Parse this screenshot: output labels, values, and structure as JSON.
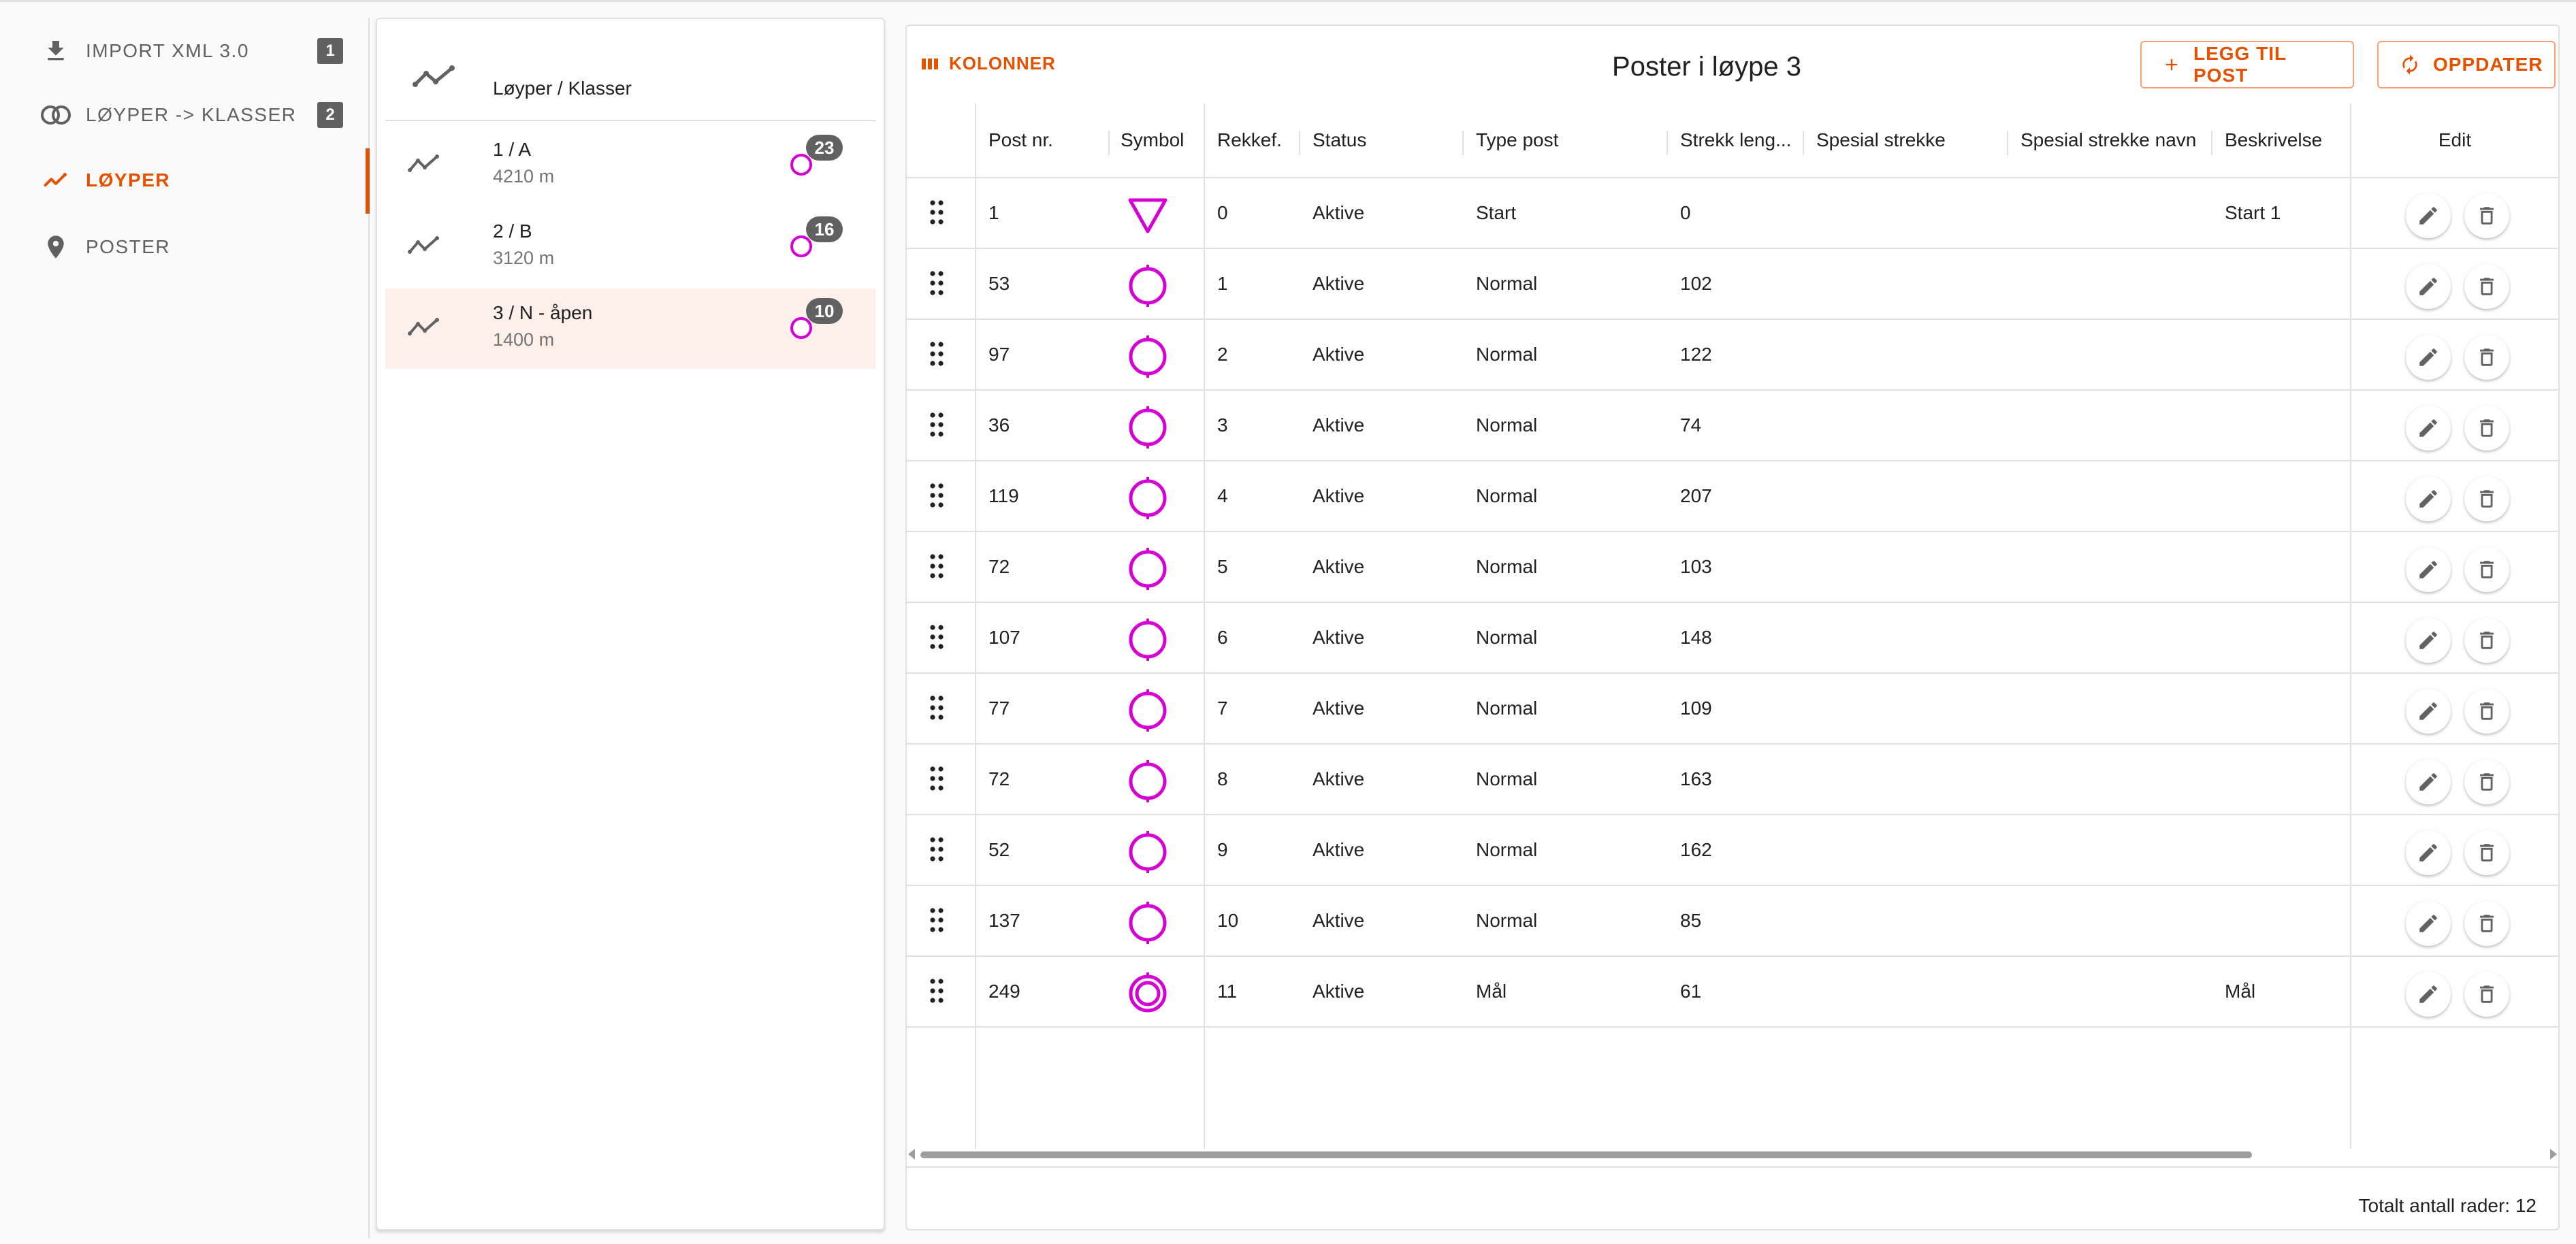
{
  "nav": {
    "items": [
      {
        "label": "IMPORT XML 3.0",
        "badge": "1",
        "icon": "download-icon"
      },
      {
        "label": "LØYPER -> KLASSER",
        "badge": "2",
        "icon": "link-circles-icon"
      },
      {
        "label": "LØYPER",
        "badge": "",
        "icon": "route-icon"
      },
      {
        "label": "POSTER",
        "badge": "",
        "icon": "location-pin-icon"
      }
    ]
  },
  "routes_panel": {
    "header": "Løyper / Klasser",
    "routes": [
      {
        "name": "1 / A",
        "length": "4210 m",
        "count": "23"
      },
      {
        "name": "2 / B",
        "length": "3120 m",
        "count": "16"
      },
      {
        "name": "3 / N - åpen",
        "length": "1400 m",
        "count": "10"
      }
    ]
  },
  "main": {
    "title": "Poster i løype 3",
    "columns_button": "KOLONNER",
    "add_button": "LEGG TIL POST",
    "refresh_button": "OPPDATER",
    "headers": {
      "post_nr": "Post nr.",
      "symbol": "Symbol",
      "order": "Rekkef.",
      "status": "Status",
      "type": "Type post",
      "length": "Strekk leng...",
      "special": "Spesial strekke",
      "special_name": "Spesial strekke navn",
      "description": "Beskrivelse",
      "edit": "Edit"
    },
    "rows": [
      {
        "post": "1",
        "symbol": "start",
        "order": "0",
        "status": "Aktive",
        "type": "Start",
        "length": "0",
        "special": "",
        "special_name": "",
        "description": "Start 1"
      },
      {
        "post": "53",
        "symbol": "control",
        "order": "1",
        "status": "Aktive",
        "type": "Normal",
        "length": "102",
        "special": "",
        "special_name": "",
        "description": ""
      },
      {
        "post": "97",
        "symbol": "control",
        "order": "2",
        "status": "Aktive",
        "type": "Normal",
        "length": "122",
        "special": "",
        "special_name": "",
        "description": ""
      },
      {
        "post": "36",
        "symbol": "control",
        "order": "3",
        "status": "Aktive",
        "type": "Normal",
        "length": "74",
        "special": "",
        "special_name": "",
        "description": ""
      },
      {
        "post": "119",
        "symbol": "control",
        "order": "4",
        "status": "Aktive",
        "type": "Normal",
        "length": "207",
        "special": "",
        "special_name": "",
        "description": ""
      },
      {
        "post": "72",
        "symbol": "control",
        "order": "5",
        "status": "Aktive",
        "type": "Normal",
        "length": "103",
        "special": "",
        "special_name": "",
        "description": ""
      },
      {
        "post": "107",
        "symbol": "control",
        "order": "6",
        "status": "Aktive",
        "type": "Normal",
        "length": "148",
        "special": "",
        "special_name": "",
        "description": ""
      },
      {
        "post": "77",
        "symbol": "control",
        "order": "7",
        "status": "Aktive",
        "type": "Normal",
        "length": "109",
        "special": "",
        "special_name": "",
        "description": ""
      },
      {
        "post": "72",
        "symbol": "control",
        "order": "8",
        "status": "Aktive",
        "type": "Normal",
        "length": "163",
        "special": "",
        "special_name": "",
        "description": ""
      },
      {
        "post": "52",
        "symbol": "control",
        "order": "9",
        "status": "Aktive",
        "type": "Normal",
        "length": "162",
        "special": "",
        "special_name": "",
        "description": ""
      },
      {
        "post": "137",
        "symbol": "control",
        "order": "10",
        "status": "Aktive",
        "type": "Normal",
        "length": "85",
        "special": "",
        "special_name": "",
        "description": ""
      },
      {
        "post": "249",
        "symbol": "finish",
        "order": "11",
        "status": "Aktive",
        "type": "Mål",
        "length": "61",
        "special": "",
        "special_name": "",
        "description": "Mål"
      }
    ],
    "total_rows": "Totalt antall rader: 12"
  },
  "colors": {
    "accent": "#e65100",
    "symbol": "#d500d5",
    "badge": "#616161"
  }
}
